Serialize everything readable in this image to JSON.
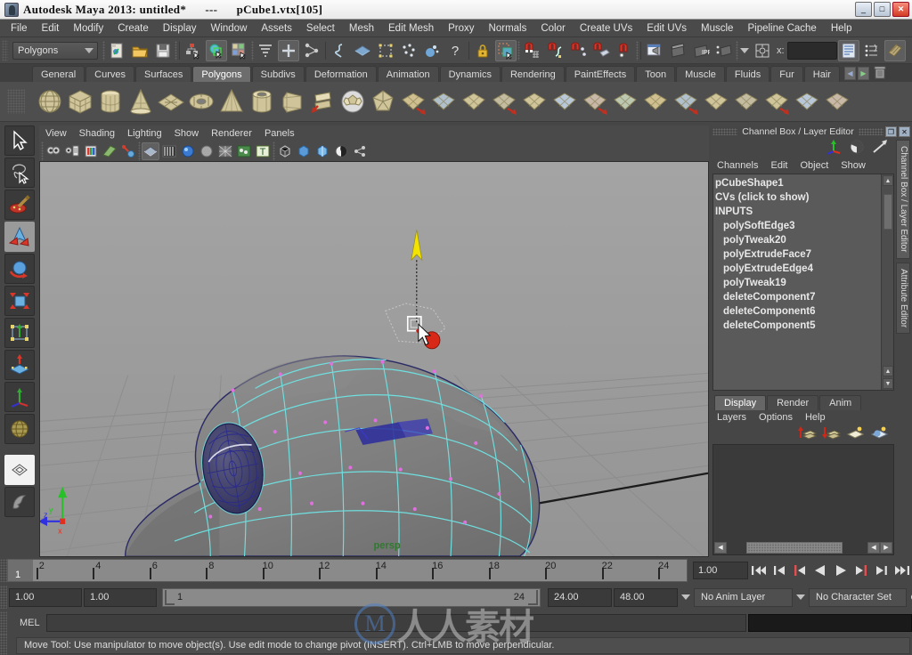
{
  "window": {
    "title": "Autodesk Maya 2013: untitled*      ---      pCube1.vtx[105]",
    "minimize": "_",
    "maximize": "□",
    "close": "✕",
    "app_icon": "maya-app-icon"
  },
  "menubar": {
    "items": [
      "File",
      "Edit",
      "Modify",
      "Create",
      "Display",
      "Window",
      "Assets",
      "Select",
      "Mesh",
      "Edit Mesh",
      "Proxy",
      "Normals",
      "Color",
      "Create UVs",
      "Edit UVs",
      "Muscle",
      "Pipeline Cache",
      "Help"
    ]
  },
  "statusline": {
    "selection_mode": "Polygons",
    "x_label": "x:",
    "x_value": "",
    "icons": [
      "new-scene-icon",
      "open-scene-icon",
      "save-scene-icon",
      "select-hierarchy-icon",
      "select-object-icon",
      "select-component-icon",
      "highlight-selection-icon",
      "select-all-icon",
      "select-connected-icon",
      "handle-mask-icon",
      "curve-mask-icon",
      "surface-mask-icon",
      "deform-mask-icon",
      "dynamic-mask-icon",
      "particle-mask-icon",
      "help-mask-icon",
      "lock-selection-icon",
      "highlight-mode-icon",
      "snap-grid-icon",
      "snap-curve-icon",
      "snap-point-icon",
      "snap-projected-icon",
      "snap-view-plane-icon",
      "construction-history-icon",
      "render-current-frame-icon",
      "ipr-render-icon",
      "render-settings-icon",
      "toggle-editor-icon",
      "attribute-editor-icon",
      "tool-settings-icon",
      "channel-box-icon"
    ]
  },
  "shelf": {
    "tabs": [
      "General",
      "Curves",
      "Surfaces",
      "Polygons",
      "Subdivs",
      "Deformation",
      "Animation",
      "Dynamics",
      "Rendering",
      "PaintEffects",
      "Toon",
      "Muscle",
      "Fluids",
      "Fur",
      "Hair"
    ],
    "active_tab": "Polygons",
    "nav_prev": "◀",
    "nav_next": "▶",
    "trash": "delete-shelf-icon",
    "icons": [
      "poly-sphere-icon",
      "poly-cube-icon",
      "poly-cylinder-icon",
      "poly-cone-icon",
      "poly-plane-icon",
      "poly-torus-icon",
      "poly-pyramid-icon",
      "poly-pipe-icon",
      "poly-prism-icon",
      "poly-helix-icon",
      "poly-soccerball-icon",
      "poly-platonic-icon",
      "poly-combine-icon",
      "poly-separate-icon",
      "poly-boolean-icon",
      "poly-mirror-icon",
      "poly-extrude-icon",
      "poly-bevel-icon",
      "poly-bridge-icon",
      "poly-append-icon",
      "poly-smooth-icon",
      "poly-split-icon",
      "poly-wedge-icon",
      "poly-sculpt-icon",
      "poly-uv-icon",
      "poly-checker-icon",
      "poly-transfer-icon"
    ]
  },
  "toolbox": {
    "tools": [
      {
        "name": "select-tool",
        "icon": "arrow-cursor-icon",
        "active": false
      },
      {
        "name": "lasso-tool",
        "icon": "lasso-icon",
        "active": false
      },
      {
        "name": "paint-select-tool",
        "icon": "paint-brush-icon",
        "active": false
      },
      {
        "name": "move-tool",
        "icon": "move-arrows-icon",
        "active": true
      },
      {
        "name": "rotate-tool",
        "icon": "rotate-sphere-icon",
        "active": false
      },
      {
        "name": "scale-tool",
        "icon": "scale-cube-icon",
        "active": false
      },
      {
        "name": "universal-manip-tool",
        "icon": "universal-manipulator-icon",
        "active": false
      },
      {
        "name": "soft-modification-tool",
        "icon": "soft-mod-icon",
        "active": false
      },
      {
        "name": "show-manipulator-tool",
        "icon": "axis-manipulator-icon",
        "active": false
      },
      {
        "name": "last-tool-used",
        "icon": "globe-icon",
        "active": false
      }
    ],
    "layouts": [
      {
        "name": "single-perspective-layout",
        "icon": "single-pane-icon"
      },
      {
        "name": "persp-outliner-layout",
        "icon": "two-pane-icon"
      }
    ]
  },
  "viewport": {
    "menus": [
      "View",
      "Shading",
      "Lighting",
      "Show",
      "Renderer",
      "Panels"
    ],
    "toolbar_icons": [
      "select-camera-icon",
      "camera-attributes-icon",
      "bookmark-icon",
      "image-plane-icon",
      "two-d-pan-zoom-icon",
      "wireframe-shaded-icon",
      "smooth-shade-all-icon",
      "smooth-shade-selected-icon",
      "flat-shade-icon",
      "wireframe-on-shaded-icon",
      "textured-icon",
      "lights-icon",
      "xray-icon",
      "xray-joints-icon",
      "shadows-icon",
      "toggle-icon"
    ],
    "camera_label": "persp",
    "axis_gizmo": {
      "x": "x",
      "y": "y",
      "z": "z"
    },
    "selected_component": "pCube1.vtx[105]",
    "grid_color": "#8f8f8f",
    "background_color": "#9b9b9b",
    "wireframe_color": "#6fe3e3",
    "selected_color": "#2a2a9e",
    "manipulator": {
      "y_axis_color": "#f2e300",
      "x_axis_color": "#e03020",
      "center": "move-manipulator-center"
    }
  },
  "channelbox": {
    "panel_title": "Channel Box / Layer Editor",
    "undock_btn": "❐",
    "close_btn": "✕",
    "header_icons": [
      "channel-box-toggle-icon",
      "attribute-editor-toggle-icon",
      "layer-editor-toggle-icon"
    ],
    "menus": [
      "Channels",
      "Edit",
      "Object",
      "Show"
    ],
    "rows": [
      {
        "label": "pCubeShape1",
        "indent": false
      },
      {
        "label": "CVs (click to show)",
        "indent": false
      },
      {
        "label": "INPUTS",
        "indent": false
      },
      {
        "label": "polySoftEdge3",
        "indent": true
      },
      {
        "label": "polyTweak20",
        "indent": true
      },
      {
        "label": "polyExtrudeFace7",
        "indent": true
      },
      {
        "label": "polyExtrudeEdge4",
        "indent": true
      },
      {
        "label": "polyTweak19",
        "indent": true
      },
      {
        "label": "deleteComponent7",
        "indent": true
      },
      {
        "label": "deleteComponent6",
        "indent": true
      },
      {
        "label": "deleteComponent5",
        "indent": true
      }
    ],
    "side_tabs": [
      "Channel Box / Layer Editor",
      "Attribute Editor"
    ],
    "active_side_tab": "Channel Box / Layer Editor"
  },
  "layereditor": {
    "tabs": [
      "Display",
      "Render",
      "Anim"
    ],
    "active_tab": "Display",
    "menus": [
      "Layers",
      "Options",
      "Help"
    ],
    "icons": [
      "new-layer-selected-icon",
      "new-layer-empty-icon",
      "layer-up-icon",
      "layer-down-icon"
    ],
    "layers": [],
    "scroll_left": "◀",
    "scroll_right": "▶"
  },
  "timeslider": {
    "current_frame": "1",
    "current_frame_field": "1.00",
    "ticks": [
      {
        "label": "2",
        "frame": 2
      },
      {
        "label": "4",
        "frame": 4
      },
      {
        "label": "6",
        "frame": 6
      },
      {
        "label": "8",
        "frame": 8
      },
      {
        "label": "10",
        "frame": 10
      },
      {
        "label": "12",
        "frame": 12
      },
      {
        "label": "14",
        "frame": 14
      },
      {
        "label": "16",
        "frame": 16
      },
      {
        "label": "18",
        "frame": 18
      },
      {
        "label": "20",
        "frame": 20
      },
      {
        "label": "22",
        "frame": 22
      },
      {
        "label": "24",
        "frame": 24
      }
    ],
    "range_start": 1,
    "range_end": 24,
    "playback_buttons": [
      "go-to-start-icon",
      "step-back-frame-icon",
      "step-back-key-icon",
      "play-backwards-icon",
      "play-forwards-icon",
      "step-forward-key-icon",
      "step-forward-frame-icon",
      "go-to-end-icon"
    ]
  },
  "rangeslider": {
    "anim_start": "1.00",
    "playback_start": "1.00",
    "range_left_label": "1",
    "range_right_label": "24",
    "playback_end": "24.00",
    "anim_end": "48.00",
    "anim_layer": "No Anim Layer",
    "character_set": "No Character Set",
    "key_icon": "auto-key-icon",
    "prefs_icon": "animation-prefs-icon"
  },
  "commandline": {
    "label": "MEL",
    "input_value": "",
    "input_placeholder": "",
    "output_value": ""
  },
  "helpline": {
    "text": "Move Tool: Use manipulator to move object(s). Use edit mode to change pivot (INSERT).  Ctrl+LMB to move perpendicular."
  },
  "watermark": {
    "logo": "M",
    "text": "人人素材"
  },
  "colors": {
    "chrome": "#464646",
    "panel": "#4a4a4a",
    "field": "#3a3a3a",
    "text": "#dcdcdc",
    "accent": "#6fe3e3",
    "viewport_bg": "#9b9b9b"
  }
}
